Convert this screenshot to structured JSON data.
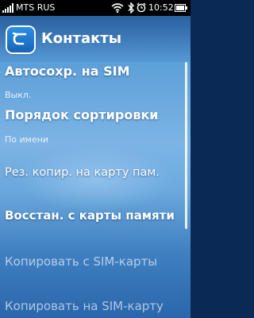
{
  "status": {
    "carrier": "MTS RUS",
    "time": "10:52",
    "icons": [
      "signal-icon",
      "wifi-icon",
      "bluetooth-icon",
      "alarm-icon",
      "battery-icon"
    ]
  },
  "header": {
    "title": "Контакты",
    "back_icon": "back-arrow-icon"
  },
  "menu": {
    "items": [
      {
        "label": "Автосохр. на SIM",
        "value": "Выкл."
      },
      {
        "label": "Порядок сортировки",
        "value": "По имени"
      },
      {
        "label": "Рез. копир. на карту пам."
      },
      {
        "label": "Восстан. с карты памяти"
      },
      {
        "label": "Копировать с SIM-карты"
      },
      {
        "label": "Копировать на SIM-карту"
      }
    ]
  },
  "colors": {
    "accent": "#1a6fd0",
    "background_top": "#3f86c8",
    "background_bottom": "#2a66ab"
  }
}
